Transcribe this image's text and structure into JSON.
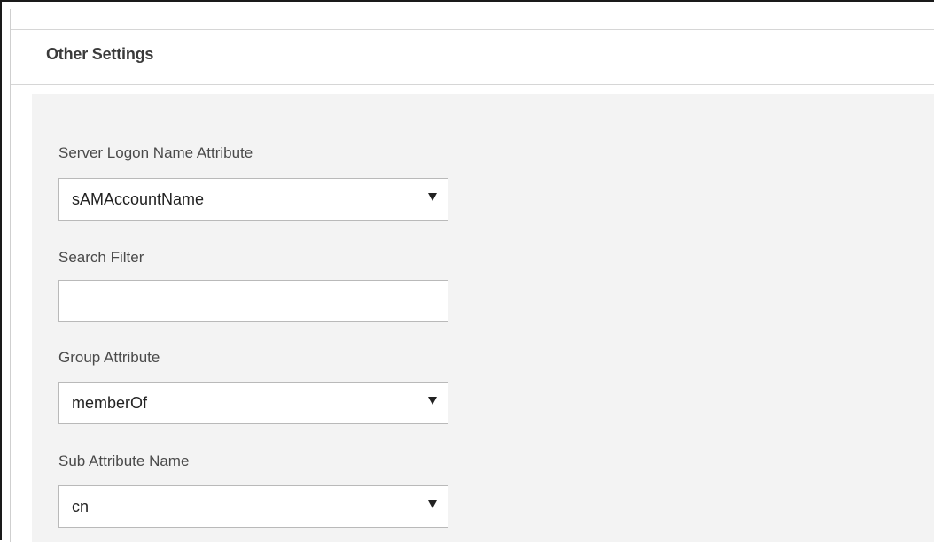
{
  "section": {
    "title": "Other Settings"
  },
  "fields": {
    "server_logon_name_attribute": {
      "label": "Server Logon Name Attribute",
      "value": "sAMAccountName"
    },
    "search_filter": {
      "label": "Search Filter",
      "value": ""
    },
    "group_attribute": {
      "label": "Group Attribute",
      "value": "memberOf"
    },
    "sub_attribute_name": {
      "label": "Sub Attribute Name",
      "value": "cn"
    }
  },
  "icons": {
    "dropdown": "chevron-down-icon"
  },
  "colors": {
    "panel_background": "#f3f3f3",
    "border": "#b9b9b9",
    "title_text": "#3b3b3b"
  }
}
